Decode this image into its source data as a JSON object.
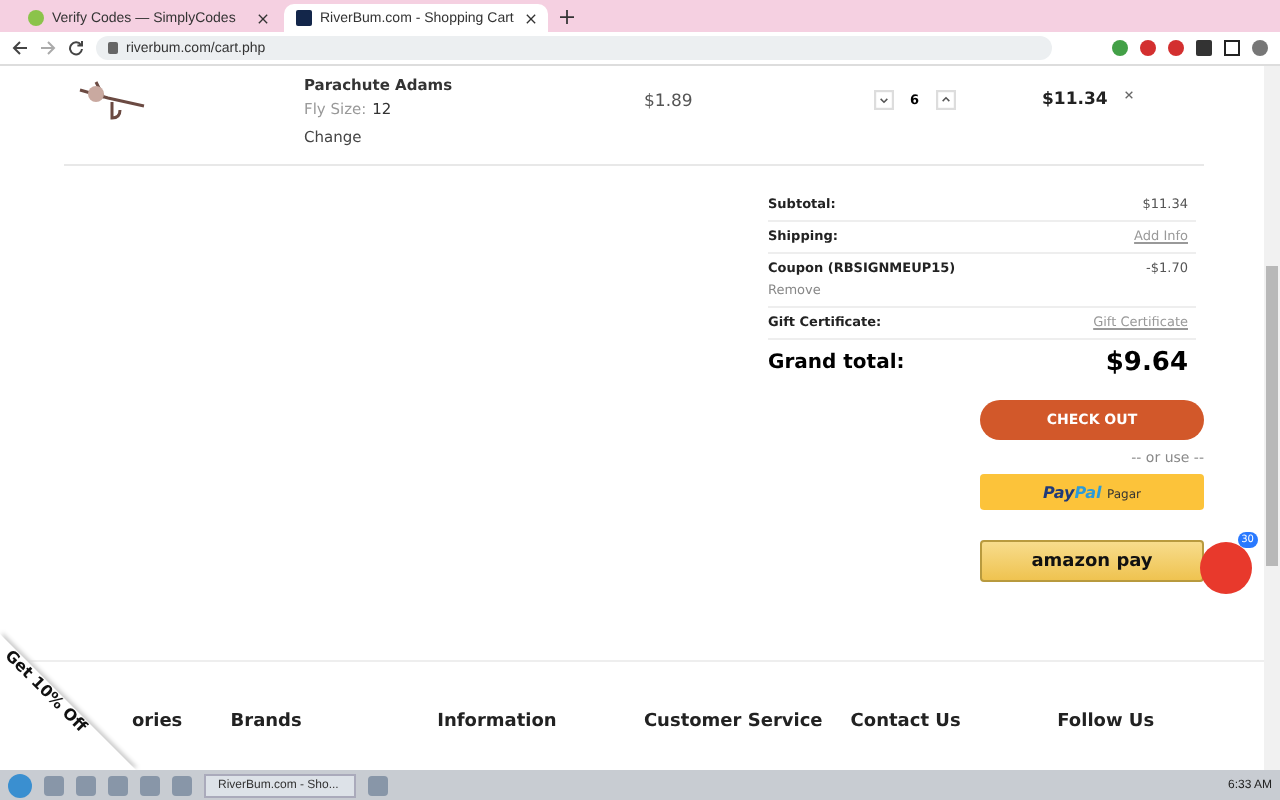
{
  "browser": {
    "tabs": [
      {
        "title": "Verify Codes — SimplyCodes",
        "selected": false
      },
      {
        "title": "RiverBum.com - Shopping Cart",
        "selected": true
      }
    ],
    "url": "riverbum.com/cart.php"
  },
  "cart_item": {
    "name": "Parachute Adams",
    "option_label": "Fly Size:",
    "option_value": "12",
    "change": "Change",
    "price": "$1.89",
    "quantity": "6",
    "total": "$11.34"
  },
  "summary": {
    "rows": [
      {
        "label": "Subtotal:",
        "value": "$11.34",
        "kind": "amount"
      },
      {
        "label": "Shipping:",
        "value": "Add Info",
        "kind": "link"
      },
      {
        "label": "Coupon (RBSIGNMEUP15)",
        "value": "-$1.70",
        "kind": "coupon",
        "action": "Remove"
      },
      {
        "label": "Gift Certificate:",
        "value": "Gift Certificate",
        "kind": "link"
      }
    ],
    "grand_label": "Grand total:",
    "grand_value": "$9.64"
  },
  "checkout": {
    "button": "CHECK OUT",
    "or_use": "-- or use --",
    "paypal_pay": "Pay",
    "paypal_pal": "Pal",
    "paypal_extra": "Pagar",
    "amazon": "amazon pay"
  },
  "chat_badge": "30",
  "promo": "Get 10% Off",
  "footer": {
    "headings": [
      "ories",
      "Brands",
      "Information",
      "Customer Service",
      "Contact Us",
      "Follow Us"
    ]
  },
  "taskbar": {
    "window": "RiverBum.com - Sho...",
    "time": "6:33 AM"
  }
}
